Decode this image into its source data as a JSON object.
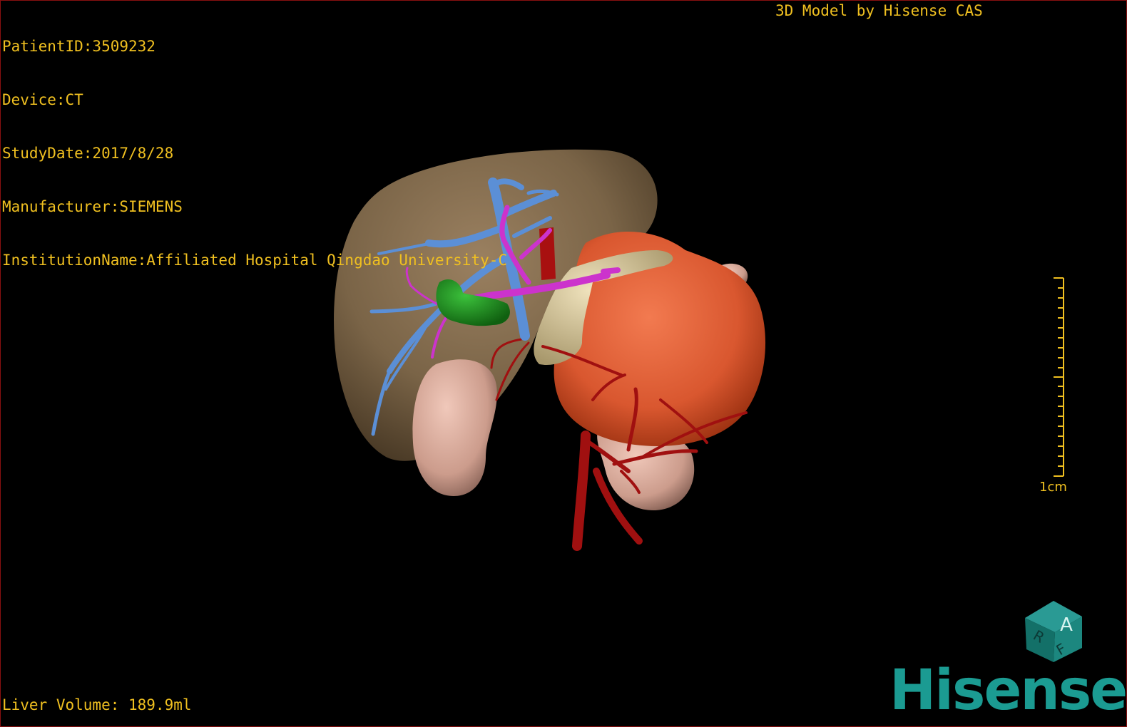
{
  "overlay": {
    "patient_id": "PatientID:3509232",
    "device": "Device:CT",
    "study_date": "StudyDate:2017/8/28",
    "manufacturer": "Manufacturer:SIEMENS",
    "institution": "InstitutionName:Affiliated Hospital Qingdao University-C",
    "model_credit": "3D Model by Hisense CAS",
    "liver_volume": "Liver Volume: 189.9ml"
  },
  "scale": {
    "label": "1cm"
  },
  "orientation_cube": {
    "face_top": "A",
    "face_front": "F",
    "face_side": "R"
  },
  "brand": {
    "name": "Hisense",
    "color": "#1b9b92"
  },
  "colors": {
    "text": "#f0c020",
    "background": "#000000",
    "border": "#8a1010",
    "liver": "#7a6447",
    "tumor": "#e0603a",
    "portal_vein": "#5b8fd6",
    "hepatic_vein": "#cc33cc",
    "gallbladder": "#1e8a1e",
    "artery": "#a01010",
    "kidney": "#d6a89a",
    "pancreas": "#d8c8a0"
  }
}
